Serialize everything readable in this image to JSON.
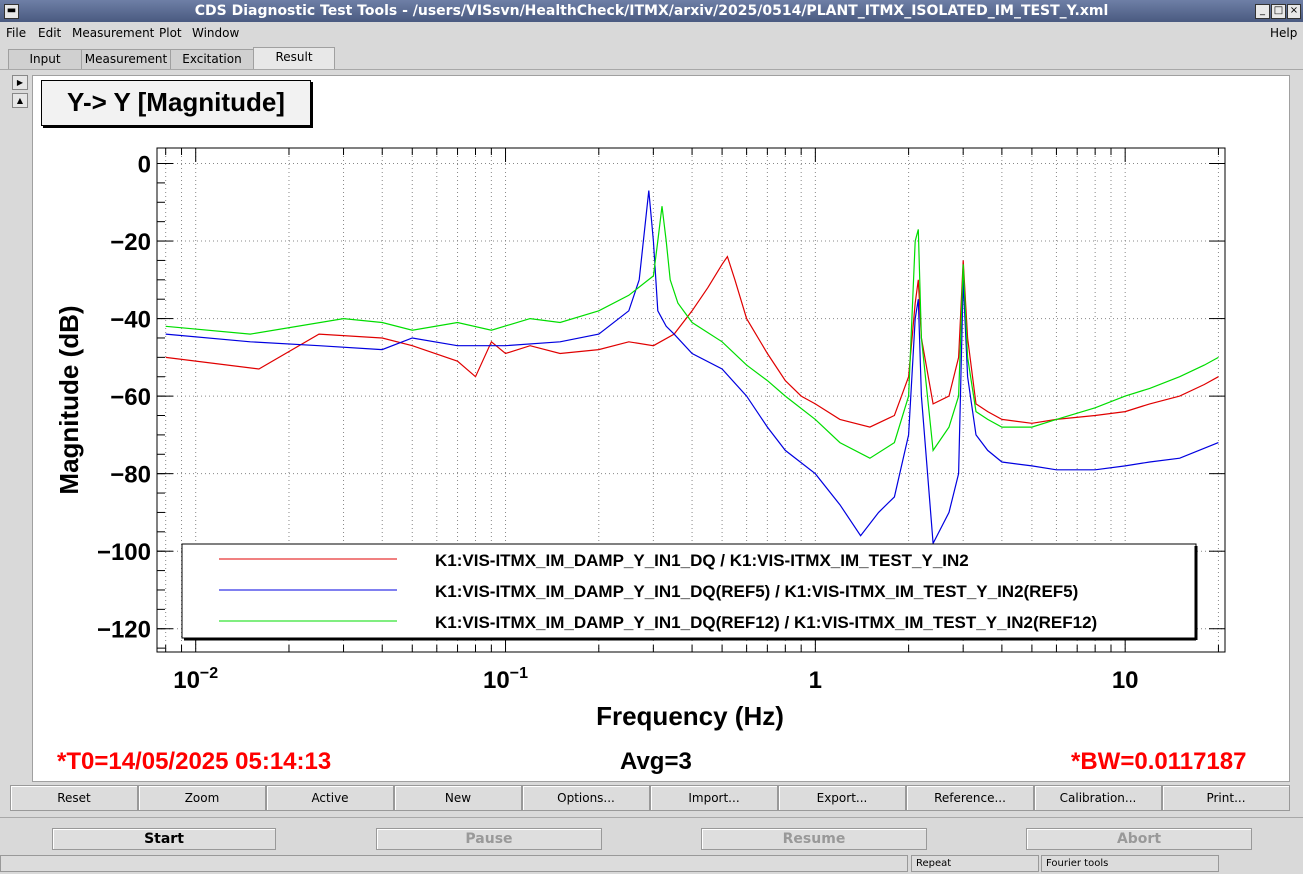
{
  "window": {
    "title": "CDS Diagnostic Test Tools - /users/VISsvn/HealthCheck/ITMX/arxiv/2025/0514/PLANT_ITMX_ISOLATED_IM_TEST_Y.xml"
  },
  "menu": {
    "file": "File",
    "edit": "Edit",
    "measurement": "Measurement",
    "plot": "Plot",
    "window": "Window",
    "help": "Help"
  },
  "tabs": [
    "Input",
    "Measurement",
    "Excitation",
    "Result"
  ],
  "plot_title": "Y-> Y [Magnitude]",
  "chart_data": {
    "type": "line",
    "title": "Y-> Y [Magnitude]",
    "xlabel": "Frequency (Hz)",
    "ylabel": "Magnitude (dB)",
    "x_scale": "log",
    "xlim": [
      0.0075,
      21
    ],
    "ylim": [
      -126,
      4
    ],
    "y_ticks": [
      0,
      -20,
      -40,
      -60,
      -80,
      -100,
      -120
    ],
    "y_tick_labels": [
      "0",
      "−20",
      "−40",
      "−60",
      "−80",
      "−100",
      "−120"
    ],
    "x_tick_labels": [
      {
        "base": "10",
        "exp": "−2",
        "value": 0.01
      },
      {
        "base": "10",
        "exp": "−1",
        "value": 0.1
      },
      {
        "base": "1",
        "exp": "",
        "value": 1
      },
      {
        "base": "10",
        "exp": "",
        "value": 10
      }
    ],
    "grid": true,
    "legend_position": "bottom",
    "series": [
      {
        "name": "K1:VIS-ITMX_IM_DAMP_Y_IN1_DQ / K1:VIS-ITMX_IM_TEST_Y_IN2",
        "color": "#e00000",
        "x": [
          0.008,
          0.016,
          0.025,
          0.04,
          0.05,
          0.07,
          0.08,
          0.09,
          0.1,
          0.12,
          0.15,
          0.2,
          0.25,
          0.3,
          0.35,
          0.4,
          0.45,
          0.5,
          0.52,
          0.55,
          0.6,
          0.7,
          0.8,
          0.9,
          1.0,
          1.2,
          1.5,
          1.8,
          2.0,
          2.1,
          2.15,
          2.2,
          2.4,
          2.7,
          2.9,
          3.0,
          3.1,
          3.3,
          3.6,
          4.0,
          5.0,
          6.0,
          8.0,
          10.0,
          12.0,
          15.0,
          18.0,
          20.0
        ],
        "y": [
          -50,
          -53,
          -44,
          -45,
          -47,
          -51,
          -55,
          -46,
          -49,
          -47,
          -49,
          -48,
          -46,
          -47,
          -44,
          -38,
          -32,
          -26,
          -24,
          -30,
          -40,
          -49,
          -56,
          -60,
          -62,
          -66,
          -68,
          -65,
          -55,
          -36,
          -30,
          -45,
          -62,
          -60,
          -50,
          -25,
          -45,
          -62,
          -64,
          -66,
          -67,
          -66,
          -65,
          -64,
          -62,
          -60,
          -57,
          -55
        ]
      },
      {
        "name": "K1:VIS-ITMX_IM_DAMP_Y_IN1_DQ(REF5) / K1:VIS-ITMX_IM_TEST_Y_IN2(REF5)",
        "color": "#0000e0",
        "x": [
          0.008,
          0.015,
          0.025,
          0.04,
          0.05,
          0.07,
          0.1,
          0.15,
          0.2,
          0.25,
          0.27,
          0.29,
          0.3,
          0.31,
          0.33,
          0.35,
          0.4,
          0.5,
          0.6,
          0.7,
          0.8,
          1.0,
          1.2,
          1.4,
          1.6,
          1.8,
          2.0,
          2.1,
          2.15,
          2.2,
          2.4,
          2.7,
          2.9,
          3.0,
          3.1,
          3.3,
          3.6,
          4.0,
          5.0,
          6.0,
          8.0,
          10.0,
          12.0,
          15.0,
          20.0
        ],
        "y": [
          -44,
          -46,
          -47,
          -48,
          -45,
          -47,
          -47,
          -46,
          -44,
          -38,
          -30,
          -7,
          -20,
          -38,
          -42,
          -44,
          -49,
          -53,
          -60,
          -68,
          -74,
          -80,
          -88,
          -96,
          -90,
          -86,
          -70,
          -40,
          -35,
          -60,
          -98,
          -90,
          -80,
          -30,
          -55,
          -70,
          -74,
          -77,
          -78,
          -79,
          -79,
          -78,
          -77,
          -76,
          -72
        ]
      },
      {
        "name": "K1:VIS-ITMX_IM_DAMP_Y_IN1_DQ(REF12) / K1:VIS-ITMX_IM_TEST_Y_IN2(REF12)",
        "color": "#00dd00",
        "x": [
          0.008,
          0.015,
          0.03,
          0.04,
          0.05,
          0.07,
          0.09,
          0.12,
          0.15,
          0.2,
          0.25,
          0.3,
          0.31,
          0.32,
          0.33,
          0.34,
          0.36,
          0.4,
          0.5,
          0.6,
          0.7,
          0.8,
          1.0,
          1.2,
          1.5,
          1.8,
          2.0,
          2.1,
          2.15,
          2.2,
          2.4,
          2.7,
          2.9,
          3.0,
          3.1,
          3.3,
          3.6,
          4.0,
          5.0,
          6.0,
          8.0,
          10.0,
          12.0,
          15.0,
          18.0,
          20.0
        ],
        "y": [
          -42,
          -44,
          -40,
          -41,
          -43,
          -41,
          -43,
          -40,
          -41,
          -38,
          -34,
          -29,
          -20,
          -11,
          -20,
          -30,
          -36,
          -41,
          -46,
          -52,
          -56,
          -60,
          -66,
          -72,
          -76,
          -72,
          -60,
          -20,
          -17,
          -45,
          -74,
          -68,
          -60,
          -26,
          -50,
          -64,
          -66,
          -68,
          -68,
          -66,
          -63,
          -60,
          -58,
          -55,
          -52,
          -50
        ]
      }
    ]
  },
  "info": {
    "t0": "*T0=14/05/2025 05:14:13",
    "avg": "Avg=3",
    "bw": "*BW=0.0117187",
    "color_red": "#ff0000",
    "color_black": "#000000"
  },
  "buttons": [
    "Reset",
    "Zoom",
    "Active",
    "New",
    "Options...",
    "Import...",
    "Export...",
    "Reference...",
    "Calibration...",
    "Print..."
  ],
  "controls": {
    "start": "Start",
    "pause": "Pause",
    "resume": "Resume",
    "abort": "Abort"
  },
  "status": {
    "repeat": "Repeat",
    "fourier": "Fourier tools"
  }
}
